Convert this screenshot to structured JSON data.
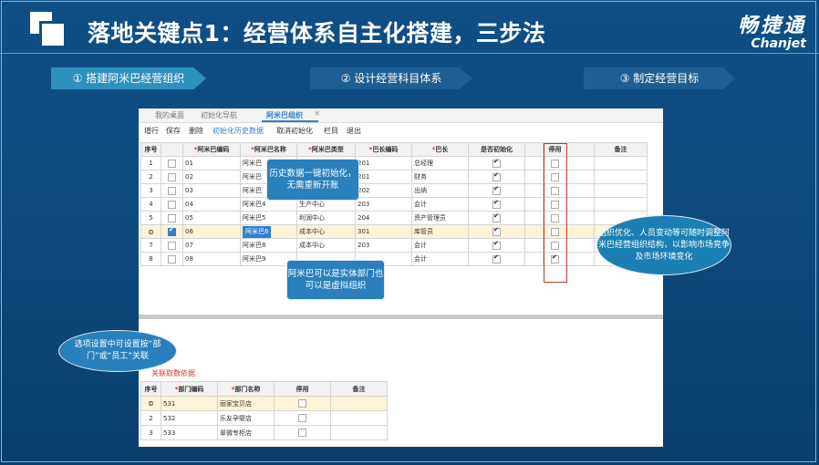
{
  "slide": {
    "title": "落地关键点1：经营体系自主化搭建，三步法",
    "brand_cn": "畅捷通",
    "brand_en": "Chanjet"
  },
  "steps": [
    {
      "label": "① 搭建阿米巴经营组织"
    },
    {
      "label": "② 设计经营科目体系"
    },
    {
      "label": "③ 制定经营目标"
    }
  ],
  "app": {
    "tabs": [
      {
        "label": "我的桌面"
      },
      {
        "label": "初始化导航"
      },
      {
        "label": "阿米巴组织"
      }
    ],
    "tab_close": "×",
    "toolbar": [
      "增行",
      "保存",
      "删除",
      "初始化历史数据",
      "取消初始化",
      "栏目",
      "退出"
    ],
    "grid": {
      "headers": [
        "序号",
        "",
        "阿米巴编码",
        "阿米巴名称",
        "阿米巴类型",
        "巴长编码",
        "巴长",
        "是否初始化",
        "",
        "停用",
        "",
        "备注"
      ],
      "rows": [
        {
          "no": "1",
          "code": "01",
          "name": "阿米巴",
          "type": "",
          "leader_code": "201",
          "leader": "总经理",
          "init": true,
          "disabled": false,
          "note": ""
        },
        {
          "no": "2",
          "code": "02",
          "name": "阿米巴",
          "type": "",
          "leader_code": "201",
          "leader": "财务",
          "init": true,
          "disabled": false,
          "note": ""
        },
        {
          "no": "3",
          "code": "03",
          "name": "阿米巴",
          "type": "",
          "leader_code": "202",
          "leader": "出纳",
          "init": true,
          "disabled": false,
          "note": ""
        },
        {
          "no": "4",
          "code": "04",
          "name": "阿米巴4",
          "type": "生产中心",
          "leader_code": "203",
          "leader": "会计",
          "init": true,
          "disabled": false,
          "note": ""
        },
        {
          "no": "5",
          "code": "05",
          "name": "阿米巴5",
          "type": "利润中心",
          "leader_code": "204",
          "leader": "资产管理员",
          "init": true,
          "disabled": false,
          "note": ""
        },
        {
          "no": "6",
          "code": "06",
          "name": "阿米巴6",
          "type": "成本中心",
          "leader_code": "301",
          "leader": "库管员",
          "init": true,
          "disabled": false,
          "note": ""
        },
        {
          "no": "7",
          "code": "07",
          "name": "阿米巴8",
          "type": "成本中心",
          "leader_code": "203",
          "leader": "会计",
          "init": true,
          "disabled": false,
          "note": ""
        },
        {
          "no": "8",
          "code": "08",
          "name": "阿米巴9",
          "type": "",
          "leader_code": "",
          "leader": "会计",
          "init": true,
          "disabled": true,
          "note": ""
        }
      ]
    },
    "sub": {
      "link": "关联取数依据",
      "headers": [
        "序号",
        "部门编码",
        "部门名称",
        "停用",
        "备注"
      ],
      "rows": [
        {
          "no": "1",
          "code": "531",
          "name": "丽家宝贝店",
          "disabled": false
        },
        {
          "no": "2",
          "code": "532",
          "name": "乐友孕婴店",
          "disabled": false
        },
        {
          "no": "3",
          "code": "533",
          "name": "翠微专柜店",
          "disabled": false
        }
      ]
    }
  },
  "callouts": {
    "history": "历史数据一键初始化，无需重新开账",
    "entity": "阿米巴可以是实体部门也可以是虚拟组织",
    "option": "选项设置中可设置按“部门”或“员工”关联",
    "adjust": "组织优化、人员变动等可随时调整阿米巴经营组织结构，以影响市场竞争及市场环境变化"
  }
}
